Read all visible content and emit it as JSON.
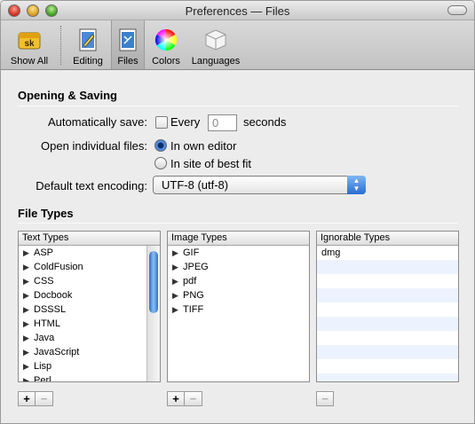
{
  "window": {
    "title": "Preferences — Files"
  },
  "toolbar": {
    "items": [
      {
        "label": "Show All",
        "icon": "app-sk-icon"
      },
      {
        "label": "Editing",
        "icon": "pencil-doc-icon"
      },
      {
        "label": "Files",
        "icon": "file-doc-icon"
      },
      {
        "label": "Colors",
        "icon": "color-wheel-icon"
      },
      {
        "label": "Languages",
        "icon": "cube-icon"
      }
    ],
    "selected": "Files"
  },
  "opening_saving": {
    "heading": "Opening & Saving",
    "autosave_label": "Automatically save:",
    "every_label": "Every",
    "every_value": "0",
    "seconds_label": "seconds",
    "open_files_label": "Open individual files:",
    "option_own": "In own editor",
    "option_best": "In site of best fit",
    "selected_option": "In own editor",
    "encoding_label": "Default text encoding:",
    "encoding_value": "UTF-8 (utf-8)"
  },
  "file_types": {
    "heading": "File Types",
    "text_types": {
      "header": "Text Types",
      "items": [
        "ASP",
        "ColdFusion",
        "CSS",
        "Docbook",
        "DSSSL",
        "HTML",
        "Java",
        "JavaScript",
        "Lisp",
        "Perl"
      ]
    },
    "image_types": {
      "header": "Image Types",
      "items": [
        "GIF",
        "JPEG",
        "pdf",
        "PNG",
        "TIFF"
      ]
    },
    "ignorable_types": {
      "header": "Ignorable Types",
      "items": [
        "dmg"
      ]
    },
    "add_label": "+",
    "remove_label": "−"
  },
  "colors": {
    "accent": "#2d6fd1",
    "stripe": "#edf3fe"
  }
}
